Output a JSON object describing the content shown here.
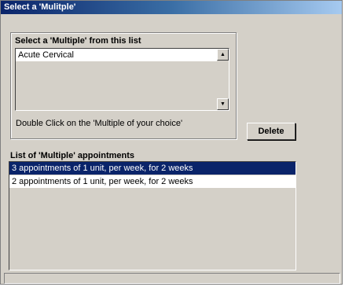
{
  "window": {
    "title": "Select a 'Mulitple'"
  },
  "picker": {
    "label": "Select a 'Multiple' from this list",
    "items": [
      "Acute Cervical"
    ],
    "hint": "Double Click on the 'Multiple of your choice'"
  },
  "scrollbar": {
    "up_icon": "triangle-up",
    "down_icon": "triangle-down"
  },
  "actions": {
    "delete_label": "Delete"
  },
  "appointments": {
    "label": "List of 'Multiple' appointments",
    "items": [
      "3 appointments of 1 unit, per week, for 2 weeks",
      "2 appointments of 1 unit, per week, for 2 weeks"
    ],
    "selected_index": 0
  },
  "colors": {
    "selection": "#0a246a",
    "face": "#d4d0c8"
  }
}
